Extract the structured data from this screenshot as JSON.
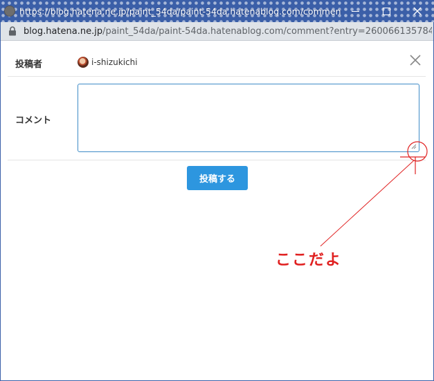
{
  "window": {
    "title": "https://blog.hatena.ne.jp/paint_54da/paint-54da.hatenablog.com/comment?entry=26...",
    "accent_color": "#3b5fa8"
  },
  "addressbar": {
    "url_domain": "blog.hatena.ne.jp",
    "url_rest": "/paint_54da/paint-54da.hatenablog.com/comment?entry=260066135784..."
  },
  "form": {
    "poster_label": "投稿者",
    "username": "i-shizukichi",
    "comment_label": "コメント",
    "comment_value": "",
    "submit_label": "投稿する",
    "submit_color": "#2d96df"
  },
  "annotation": {
    "text": "ここだよ",
    "color": "#e02020"
  }
}
